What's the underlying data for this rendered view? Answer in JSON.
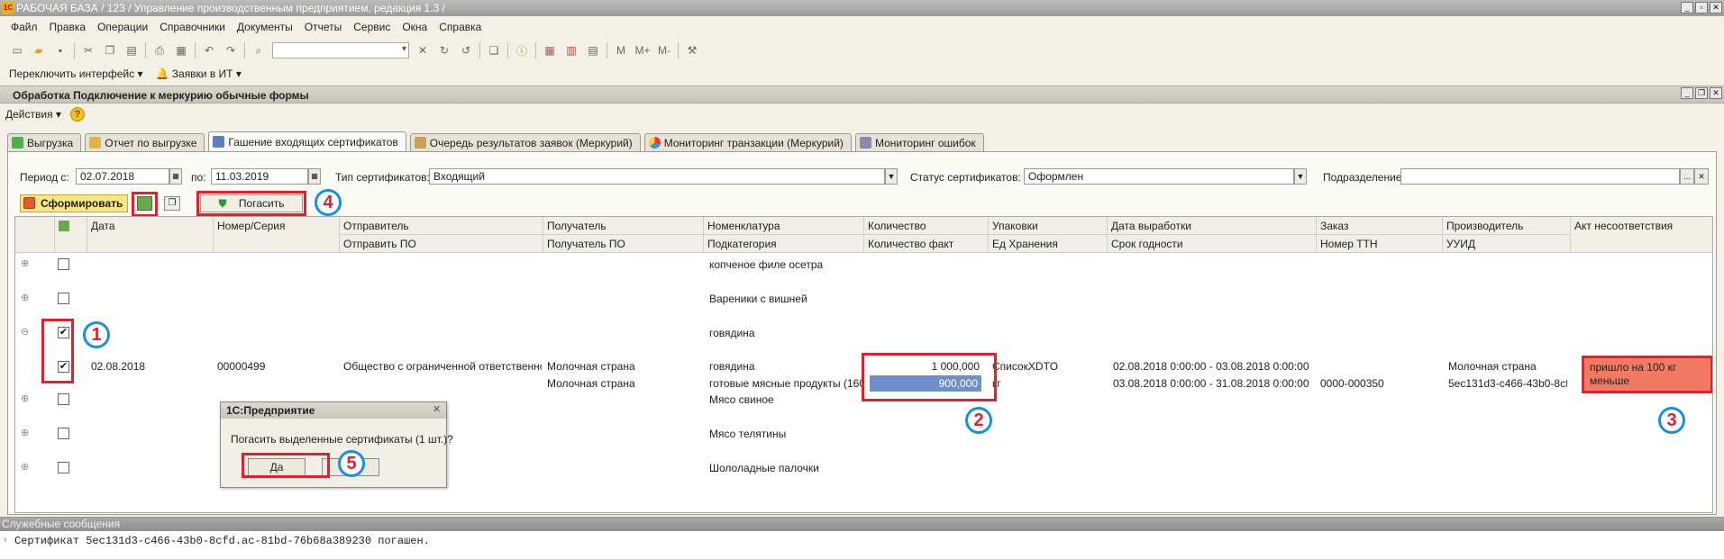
{
  "window": {
    "title": "РАБОЧАЯ БАЗА / 123 /  Управление производственным предприятием, редакция 1.3 /",
    "app_icon": "1С"
  },
  "menu": [
    "Файл",
    "Правка",
    "Операции",
    "Справочники",
    "Документы",
    "Отчеты",
    "Сервис",
    "Окна",
    "Справка"
  ],
  "toolbar2": {
    "switch_interface": "Переключить интерфейс",
    "requests": "Заявки в ИТ"
  },
  "form": {
    "title": "Обработка  Подключение к меркурию обычные формы"
  },
  "actions": {
    "label": "Действия"
  },
  "tabs": [
    "Выгрузка",
    "Отчет по выгрузке",
    "Гашение входящих сертификатов",
    "Очередь результатов заявок (Меркурий)",
    "Мониторинг транзакции (Меркурий)",
    "Мониторинг ошибок"
  ],
  "filters": {
    "period_from_label": "Период с:",
    "period_from": "02.07.2018",
    "period_to_label": "по:",
    "period_to": "11.03.2019",
    "cert_type_label": "Тип сертификатов:",
    "cert_type": "Входящий",
    "cert_status_label": "Статус сертификатов:",
    "cert_status": "Оформлен",
    "subdivision_label": "Подразделение:",
    "subdivision": ""
  },
  "buttons": {
    "form_label": "Сформировать",
    "redeem_label": "Погасить"
  },
  "grid": {
    "header_row1": [
      "Дата",
      "Номер/Серия",
      "Отправитель",
      "Получатель",
      "Номенклатура",
      "Количество",
      "Упаковки",
      "Дата выработки",
      "Заказ",
      "Производитель",
      "Акт несоответствия"
    ],
    "header_row2": [
      "Отправить ПО",
      "Получатель ПО",
      "Подкатегория",
      "Количество факт",
      "Ед Хранения",
      "Срок годности",
      "Номер ТТН",
      "УУИД"
    ],
    "groups": [
      {
        "name": "копченое филе осетра",
        "checked": false,
        "expanded": false
      },
      {
        "name": "Вареники с вишней",
        "checked": false,
        "expanded": false
      },
      {
        "name": "говядина",
        "checked": true,
        "expanded": true
      },
      {
        "name": "Мясо свиное",
        "checked": false,
        "expanded": false
      },
      {
        "name": "Мясо телятины",
        "checked": false,
        "expanded": false
      },
      {
        "name": "Шололадные палочки",
        "checked": false,
        "expanded": false
      }
    ],
    "detail": {
      "checked": true,
      "date": "02.08.2018",
      "number": "00000499",
      "sender": "Общество с ограниченной ответственно...",
      "receiver": "Молочная страна",
      "nomenclature": "говядина",
      "quantity": "1 000,000",
      "packages": "СписокXDTO",
      "production_date": "02.08.2018 0:00:00 - 03.08.2018 0:00:00",
      "manufacturer": "Молочная страна",
      "act": "пришло на 100 кг меньше",
      "receiver_po": "Молочная страна",
      "subcategory": "готовые мясные продукты (1601)",
      "quantity_fact": "900,000",
      "unit": "кг",
      "expiry": "03.08.2018 0:00:00 - 31.08.2018 0:00:00",
      "ttn": "0000-000350",
      "uuid": "5ec131d3-c466-43b0-8cfd..."
    }
  },
  "dialog": {
    "title": "1С:Предприятие",
    "message": "Погасить выделенные сертификаты (1 шт.)?",
    "yes": "Да",
    "no": "Нет"
  },
  "annotations": [
    "1",
    "2",
    "3",
    "4",
    "5"
  ],
  "messages": {
    "title": "Служебные сообщения",
    "text": "Сертификат 5ec131d3-c466-43b0-8cfd.ac-81bd-76b68a389230 погашен."
  },
  "icons": [
    "app-icon",
    "new-doc-icon",
    "open-icon",
    "save-icon",
    "cut-icon",
    "copy-icon",
    "paste-icon",
    "print-icon",
    "undo-icon",
    "redo-icon",
    "find-icon",
    "info-icon",
    "calendar-icon",
    "bell-icon",
    "help-icon"
  ]
}
